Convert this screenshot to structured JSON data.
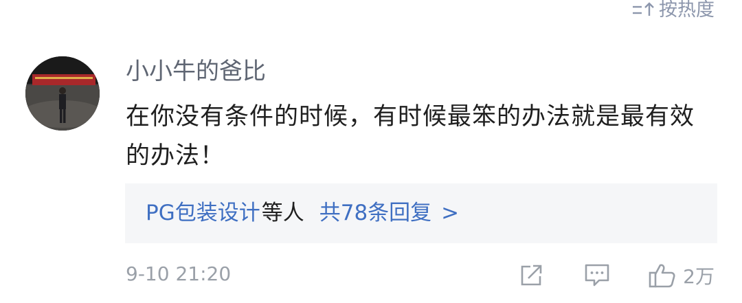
{
  "sort": {
    "label": "按热度",
    "icon": "sort-arrows-icon"
  },
  "comment": {
    "username": "小小牛的爸比",
    "text": "在你没有条件的时候，有时候最笨的办法就是最有效的办法！",
    "avatar": "user-avatar-photo",
    "replies": {
      "users": "PG包装设计",
      "suffix": "等人",
      "count": "共78条回复",
      "chevron": ">"
    },
    "timestamp": "9-10 21:20",
    "actions": {
      "share_icon": "share-icon",
      "comment_icon": "comment-icon",
      "like_icon": "thumbs-up-icon",
      "like_count": "2万"
    }
  },
  "colors": {
    "link": "#3f6fc2",
    "muted": "#9aa0a8",
    "reply_bg": "#f5f6f8"
  }
}
